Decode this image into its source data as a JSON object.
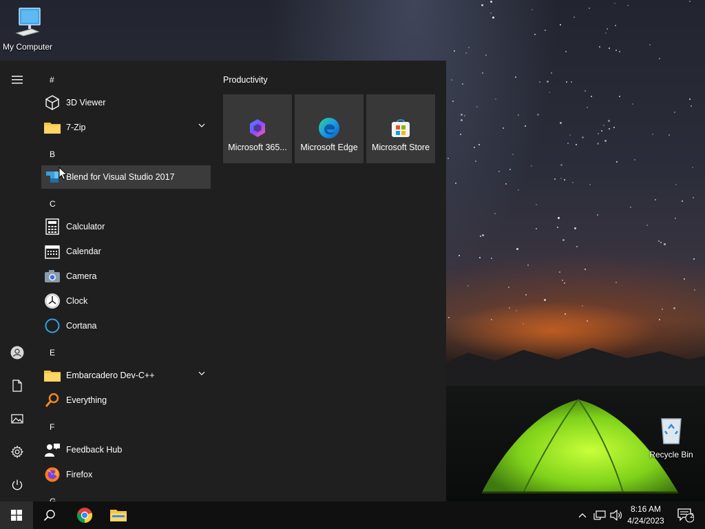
{
  "desktop": {
    "my_computer_label": "My Computer",
    "recycle_bin_label": "Recycle Bin"
  },
  "start_menu": {
    "apps": [
      {
        "type": "letter",
        "label": "#"
      },
      {
        "type": "app",
        "label": "3D Viewer",
        "icon": "cube-icon"
      },
      {
        "type": "app",
        "label": "7-Zip",
        "icon": "folder-icon",
        "expandable": true
      },
      {
        "type": "letter",
        "label": "B"
      },
      {
        "type": "app",
        "label": "Blend for Visual Studio 2017",
        "icon": "blend-icon",
        "hovered": true
      },
      {
        "type": "letter",
        "label": "C"
      },
      {
        "type": "app",
        "label": "Calculator",
        "icon": "calculator-icon"
      },
      {
        "type": "app",
        "label": "Calendar",
        "icon": "calendar-icon"
      },
      {
        "type": "app",
        "label": "Camera",
        "icon": "camera-icon"
      },
      {
        "type": "app",
        "label": "Clock",
        "icon": "clock-icon"
      },
      {
        "type": "app",
        "label": "Cortana",
        "icon": "cortana-icon"
      },
      {
        "type": "letter",
        "label": "E"
      },
      {
        "type": "app",
        "label": "Embarcadero Dev-C++",
        "icon": "folder-icon",
        "expandable": true
      },
      {
        "type": "app",
        "label": "Everything",
        "icon": "everything-search-icon"
      },
      {
        "type": "letter",
        "label": "F"
      },
      {
        "type": "app",
        "label": "Feedback Hub",
        "icon": "feedback-hub-icon"
      },
      {
        "type": "app",
        "label": "Firefox",
        "icon": "firefox-icon"
      },
      {
        "type": "letter",
        "label": "G"
      }
    ],
    "tile_group": {
      "title": "Productivity",
      "tiles": [
        {
          "label": "Microsoft 365...",
          "icon": "microsoft-365-icon"
        },
        {
          "label": "Microsoft Edge",
          "icon": "edge-icon"
        },
        {
          "label": "Microsoft Store",
          "icon": "store-icon"
        }
      ]
    },
    "rail": [
      "hamburger-icon",
      "user-icon",
      "documents-icon",
      "pictures-icon",
      "settings-icon",
      "power-icon"
    ]
  },
  "taskbar": {
    "pinned": [
      "windows-start-icon",
      "search-icon",
      "chrome-icon",
      "file-explorer-icon"
    ],
    "tray_icons": [
      "chevron-up-icon",
      "network-icon",
      "volume-icon"
    ],
    "time": "8:16 AM",
    "date": "4/24/2023",
    "notification_count": "2"
  },
  "colors": {
    "start_bg": "#1f1f1f",
    "tile_bg": "#383838",
    "hover_bg": "#3b3b3b",
    "taskbar_bg": "#101010"
  }
}
